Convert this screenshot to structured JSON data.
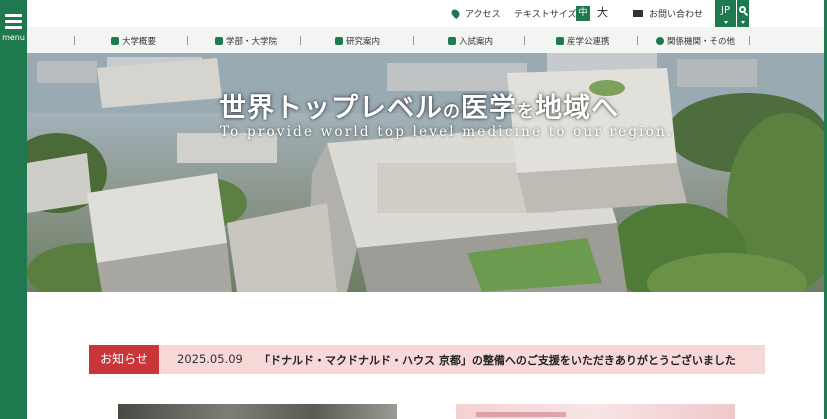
{
  "side": {
    "menu_label": "menu"
  },
  "utility": {
    "access": "アクセス",
    "text_size_label": "テキストサイズ",
    "text_size_medium": "中",
    "text_size_large": "大",
    "contact": "お問い合わせ",
    "language": "JP"
  },
  "nav": {
    "items": [
      {
        "label": "大学概要",
        "icon": "building-icon"
      },
      {
        "label": "学部・大学院",
        "icon": "graduation-cap-icon"
      },
      {
        "label": "研究案内",
        "icon": "flask-icon"
      },
      {
        "label": "入試案内",
        "icon": "pencil-icon"
      },
      {
        "label": "産学公連携",
        "icon": "handshake-icon"
      },
      {
        "label": "関係機関・その他",
        "icon": "globe-icon"
      }
    ]
  },
  "hero": {
    "headline_a": "世界トップレベル",
    "headline_b": "の",
    "headline_c": "医学",
    "headline_d": "を",
    "headline_e": "地域へ",
    "subline": "To provide world top level medicine to our region."
  },
  "news": {
    "tag": "お知らせ",
    "date": "2025.05.09",
    "title": "「ドナルド・マクドナルド・ハウス 京都」の整備へのご支援をいただきありがとうございました"
  },
  "colors": {
    "brand_green": "#1e7a4e",
    "news_red": "#c9363a",
    "news_bg": "#f6d8d6"
  }
}
